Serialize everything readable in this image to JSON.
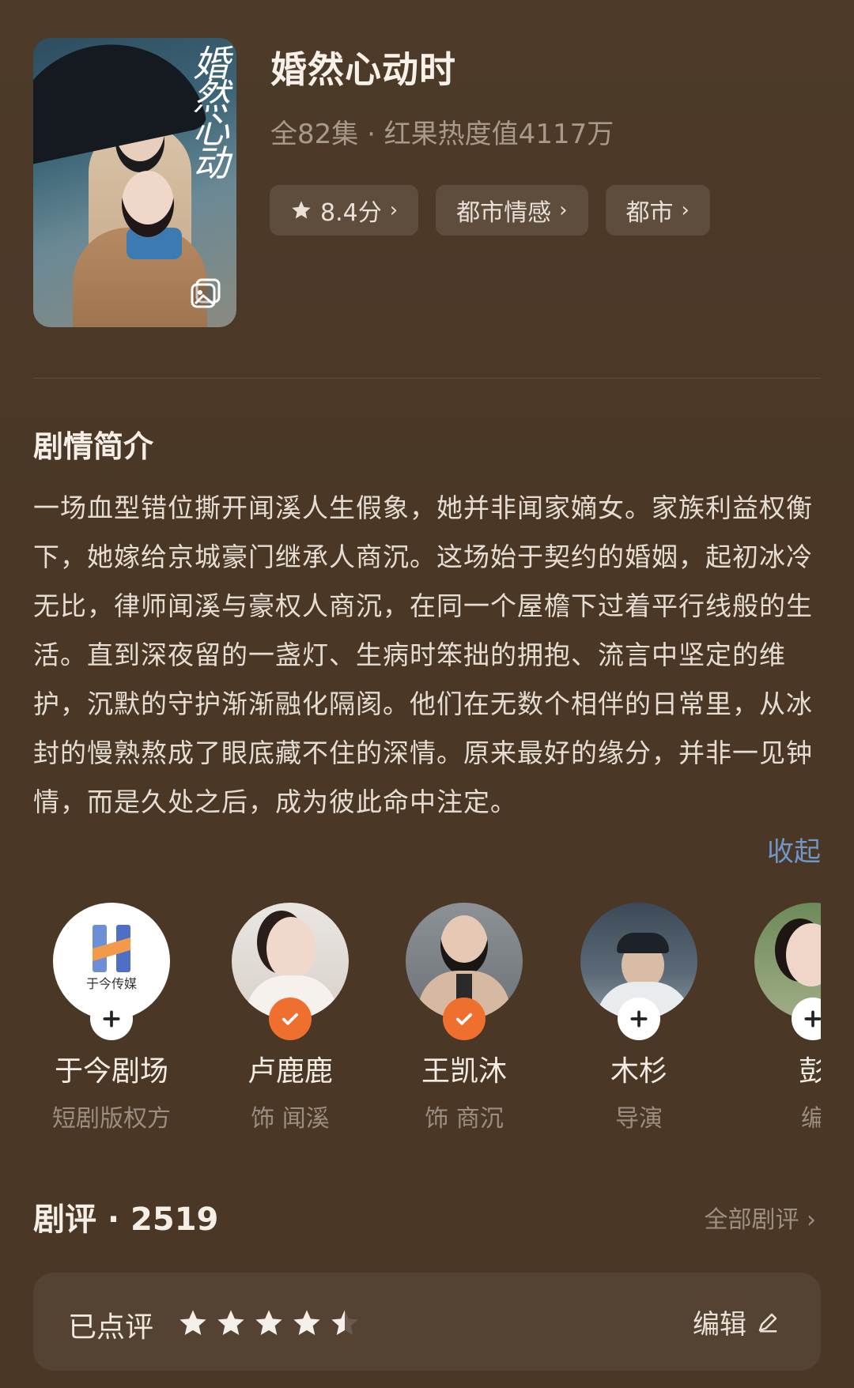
{
  "drama": {
    "title": "婚然心动时",
    "meta": "全82集 · 红果热度值4117万",
    "poster_title": "婚然心动",
    "tags": [
      {
        "label": "8.4分",
        "icon": "star-icon"
      },
      {
        "label": "都市情感"
      },
      {
        "label": "都市"
      }
    ]
  },
  "synopsis": {
    "heading": "剧情简介",
    "text": "一场血型错位撕开闻溪人生假象，她并非闻家嫡女。家族利益权衡下，她嫁给京城豪门继承人商沉。这场始于契约的婚姻，起初冰冷无比，律师闻溪与豪权人商沉，在同一个屋檐下过着平行线般的生活。直到深夜留的一盏灯、生病时笨拙的拥抱、流言中坚定的维护，沉默的守护渐渐融化隔阂。他们在无数个相伴的日常里，从冰封的慢熟熬成了眼底藏不住的深情。原来最好的缘分，并非一见钟情，而是久处之后，成为彼此命中注定。",
    "collapse_label": "收起"
  },
  "cast": [
    {
      "name": "于今剧场",
      "role": "短剧版权方",
      "badge": "plus",
      "logo_text": "于今传媒"
    },
    {
      "name": "卢鹿鹿",
      "role": "饰 闻溪",
      "badge": "check"
    },
    {
      "name": "王凯沐",
      "role": "饰 商沉",
      "badge": "check"
    },
    {
      "name": "木杉",
      "role": "导演",
      "badge": "plus"
    },
    {
      "name": "彭",
      "role": "编",
      "badge": "plus"
    }
  ],
  "reviews": {
    "heading": "剧评 · 2519",
    "all_label": "全部剧评 ›",
    "rated_label": "已点评",
    "rating": 4.5,
    "edit_label": "编辑"
  },
  "colors": {
    "background": "#4a3726",
    "accent_orange": "#ee6f2e",
    "link_blue": "#6f98c9"
  }
}
